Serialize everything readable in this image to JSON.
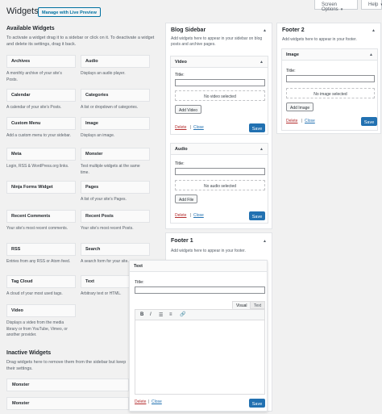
{
  "header": {
    "title": "Widgets",
    "preview_label": "Manage with Live Preview",
    "screen_options": "Screen Options",
    "help": "Help"
  },
  "available": {
    "title": "Available Widgets",
    "description": "To activate a widget drag it to a sidebar or click on it. To deactivate a widget and delete its settings, drag it back.",
    "widgets": [
      {
        "name": "Archives",
        "desc": "A monthly archive of your site’s Posts."
      },
      {
        "name": "Audio",
        "desc": "Displays an audio player."
      },
      {
        "name": "Calendar",
        "desc": "A calendar of your site’s Posts."
      },
      {
        "name": "Categories",
        "desc": "A list or dropdown of categories."
      },
      {
        "name": "Custom Menu",
        "desc": "Add a custom menu to your sidebar."
      },
      {
        "name": "Image",
        "desc": "Displays an image."
      },
      {
        "name": "Meta",
        "desc": "Login, RSS & WordPress.org links."
      },
      {
        "name": "Monster",
        "desc": "Test multiple widgets at the same time."
      },
      {
        "name": "Ninja Forms Widget",
        "desc": ""
      },
      {
        "name": "Pages",
        "desc": "A list of your site’s Pages."
      },
      {
        "name": "Recent Comments",
        "desc": "Your site’s most recent comments."
      },
      {
        "name": "Recent Posts",
        "desc": "Your site’s most recent Posts."
      },
      {
        "name": "RSS",
        "desc": "Entries from any RSS or Atom feed."
      },
      {
        "name": "Search",
        "desc": "A search form for your site."
      },
      {
        "name": "Tag Cloud",
        "desc": "A cloud of your most used tags."
      },
      {
        "name": "Text",
        "desc": "Arbitrary text or HTML."
      },
      {
        "name": "Video",
        "desc": "Displays a video from the media library or from YouTube, Vimeo, or another provider."
      }
    ]
  },
  "inactive": {
    "title": "Inactive Widgets",
    "description": "Drag widgets here to remove them from the sidebar but keep their settings.",
    "widgets": [
      "Monster",
      "Monster"
    ]
  },
  "blog_sidebar": {
    "title": "Blog Sidebar",
    "description": "Add widgets here to appear in your sidebar on blog posts and archive pages.",
    "video": {
      "title": "Video",
      "field": "Title:",
      "empty": "No video selected",
      "add": "Add Video",
      "delete": "Delete",
      "close": "Close",
      "save": "Save"
    },
    "audio": {
      "title": "Audio",
      "field": "Title:",
      "empty": "No audio selected",
      "add": "Add File",
      "delete": "Delete",
      "close": "Close",
      "save": "Save"
    }
  },
  "footer1": {
    "title": "Footer 1",
    "description": "Add widgets here to appear in your footer.",
    "text": {
      "title": "Text",
      "field": "Title:",
      "tab_visual": "Visual",
      "tab_text": "Text",
      "delete": "Delete",
      "close": "Close",
      "save": "Save"
    }
  },
  "footer2": {
    "title": "Footer 2",
    "description": "Add widgets here to appear in your footer.",
    "image": {
      "title": "Image",
      "field": "Title:",
      "empty": "No image selected",
      "add": "Add Image",
      "delete": "Delete",
      "close": "Close",
      "save": "Save"
    }
  },
  "separators": {
    "pipe": "|"
  },
  "toolbar": {
    "bold": "B",
    "italic": "I",
    "bullets": "☰",
    "numbers": "≡",
    "link": "🔗"
  },
  "icons": {
    "caret": "▾",
    "collapse": "▲"
  }
}
